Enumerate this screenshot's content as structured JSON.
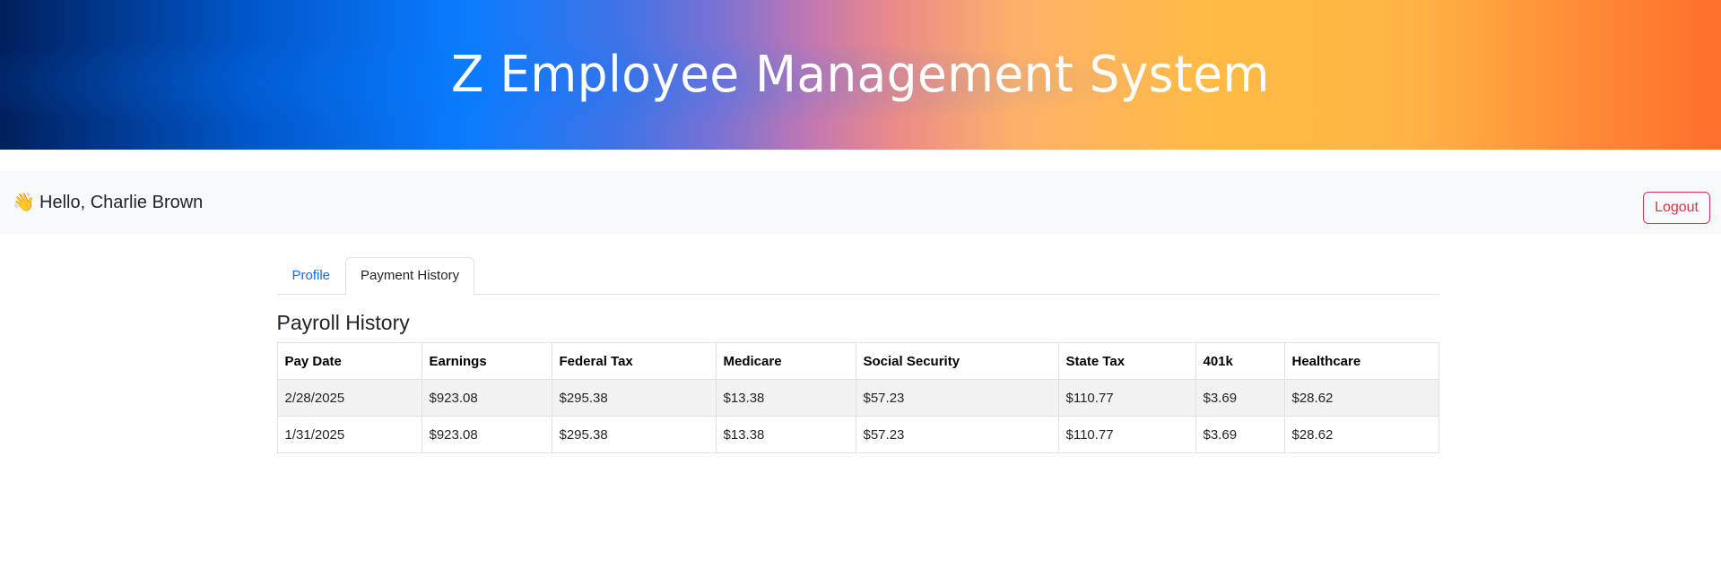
{
  "header": {
    "title": "Z Employee Management System"
  },
  "user_bar": {
    "wave_icon": "👋",
    "greeting": "Hello, Charlie Brown",
    "logout_label": "Logout",
    "logout_color": "#dc3545"
  },
  "tabs": [
    {
      "label": "Profile",
      "active": false
    },
    {
      "label": "Payment History",
      "active": true
    }
  ],
  "payroll": {
    "title": "Payroll History",
    "columns": [
      "Pay Date",
      "Earnings",
      "Federal Tax",
      "Medicare",
      "Social Security",
      "State Tax",
      "401k",
      "Healthcare"
    ],
    "rows": [
      [
        "2/28/2025",
        "$923.08",
        "$295.38",
        "$13.38",
        "$57.23",
        "$110.77",
        "$3.69",
        "$28.62"
      ],
      [
        "1/31/2025",
        "$923.08",
        "$295.38",
        "$13.38",
        "$57.23",
        "$110.77",
        "$3.69",
        "$28.62"
      ]
    ]
  }
}
